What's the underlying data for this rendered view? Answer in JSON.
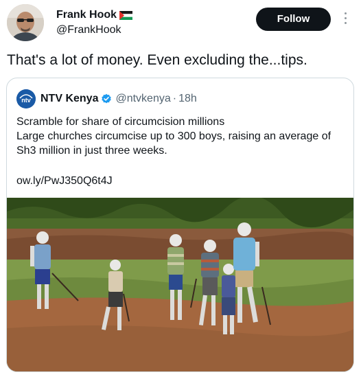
{
  "author": {
    "display_name": "Frank Hook",
    "handle": "@FrankHook",
    "flag_icon": "palestine-flag-icon"
  },
  "follow_label": "Follow",
  "more_icon": "more-vertical-icon",
  "tweet": {
    "text": "That's a lot of money. Even excluding the...tips."
  },
  "quote": {
    "logo_text": "ntv",
    "display_name": "NTV Kenya",
    "verified_icon": "verified-badge-icon",
    "handle": "@ntvkenya",
    "separator": "·",
    "time": "18h",
    "body_lines": [
      "Scramble for share of circumcision millions",
      "Large churches circumcise up to 300 boys, raising an average of Sh3 million in just three weeks."
    ],
    "link": "ow.ly/PwJ350Q6t4J",
    "photo_icon": "photo-boys-painted-white"
  },
  "colors": {
    "text": "#0f1419",
    "secondary": "#536471",
    "border": "#cfd9de",
    "verified": "#1d9bf0",
    "ntv_blue": "#1a5aa6"
  }
}
